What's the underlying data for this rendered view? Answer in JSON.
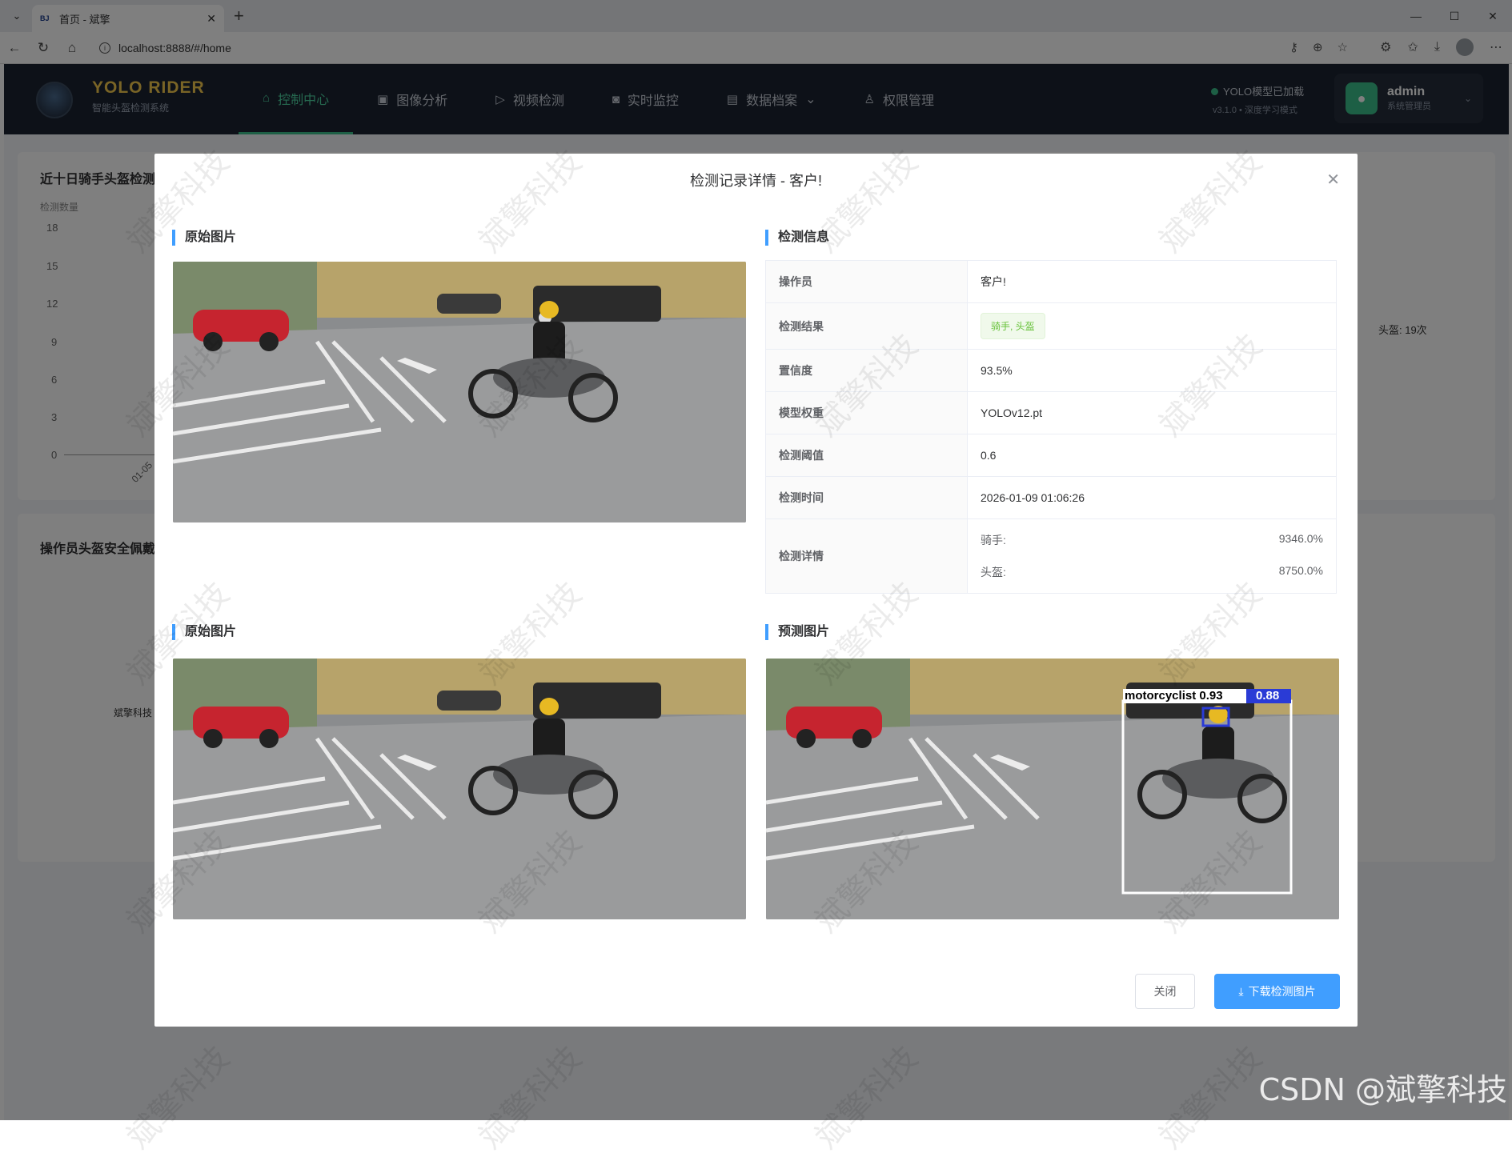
{
  "browser": {
    "tab_title": "首页 - 斌擎",
    "favicon_text": "BJ",
    "url": "localhost:8888/#/home"
  },
  "header": {
    "brand_title": "YOLO RIDER",
    "brand_subtitle": "智能头盔检测系统",
    "nav": [
      {
        "label": "控制中心",
        "icon": "home-icon"
      },
      {
        "label": "图像分析",
        "icon": "image-icon"
      },
      {
        "label": "视频检测",
        "icon": "play-icon"
      },
      {
        "label": "实时监控",
        "icon": "camera-icon"
      },
      {
        "label": "数据档案",
        "icon": "document-icon"
      },
      {
        "label": "权限管理",
        "icon": "user-icon"
      }
    ],
    "model_status": "YOLO模型已加载",
    "model_version": "v3.1.0 • 深度学习模式",
    "user_name": "admin",
    "user_role": "系统管理员"
  },
  "background": {
    "chart1_title": "近十日骑手头盔检测",
    "chart1_ylabel": "检测数量",
    "chart1_yticks": [
      "18",
      "15",
      "12",
      "9",
      "6",
      "3",
      "0"
    ],
    "chart1_xtick": "01-05",
    "pie_legend": "头盔: 19次",
    "chart2_title": "操作员头盔安全佩戴",
    "chart2_label": "斌擎科技"
  },
  "dialog": {
    "title": "检测记录详情 - 客户!",
    "section_info_left": "原始图片",
    "section_info_right": "检测信息",
    "section_bottom_left": "原始图片",
    "section_bottom_right": "预测图片",
    "rows": [
      {
        "label": "操作员",
        "value": "客户!"
      },
      {
        "label": "检测结果",
        "value": "骑手, 头盔"
      },
      {
        "label": "置信度",
        "value": "93.5%"
      },
      {
        "label": "模型权重",
        "value": "YOLOv12.pt"
      },
      {
        "label": "检测阈值",
        "value": "0.6"
      },
      {
        "label": "检测时间",
        "value": "2026-01-09 01:06:26"
      }
    ],
    "details_label": "检测详情",
    "details": [
      {
        "name": "骑手:",
        "value": "9346.0%"
      },
      {
        "name": "头盔:",
        "value": "8750.0%"
      }
    ],
    "bbox_label_1": "motorcyclist 0.93",
    "bbox_label_2": "0.88",
    "close_button": "关闭",
    "download_button": "下载检测图片"
  },
  "watermark": "斌擎科技",
  "csdn_mark": "CSDN @斌擎科技",
  "colors": {
    "primary": "#409eff",
    "accent": "#3bbf8a",
    "brand": "#f2c94c"
  }
}
